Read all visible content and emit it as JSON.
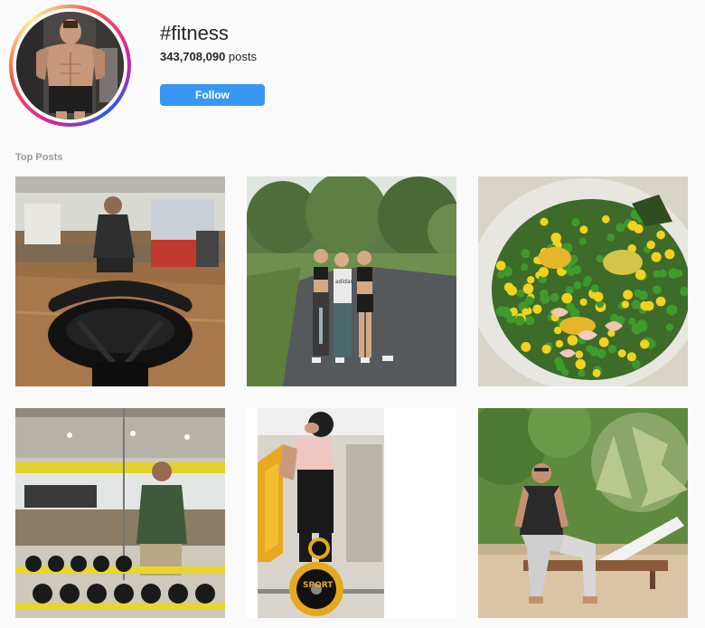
{
  "tag": {
    "name": "#fitness",
    "post_count": "343,708,090",
    "post_suffix": " posts",
    "follow_label": "Follow"
  },
  "sections": {
    "top_posts_title": "Top Posts"
  },
  "posts": [
    {
      "subject": "man with kettlebell in gym",
      "icon": "gym-kettlebell-photo"
    },
    {
      "subject": "three women on path",
      "icon": "group-photo"
    },
    {
      "subject": "salad with peas corn and shrimp",
      "icon": "food-photo"
    },
    {
      "subject": "man in gym mirror with dumbbells",
      "icon": "gym-mirror-photo"
    },
    {
      "subject": "woman lifting barbell",
      "icon": "barbell-photo"
    },
    {
      "subject": "man sitting on lounger",
      "icon": "outdoor-photo"
    }
  ],
  "image_text": {
    "shirt_brand": "adidas",
    "plate_text": "SPORT"
  },
  "colors": {
    "follow_button": "#3897f0",
    "background": "#fafafa",
    "muted_text": "#999999"
  }
}
